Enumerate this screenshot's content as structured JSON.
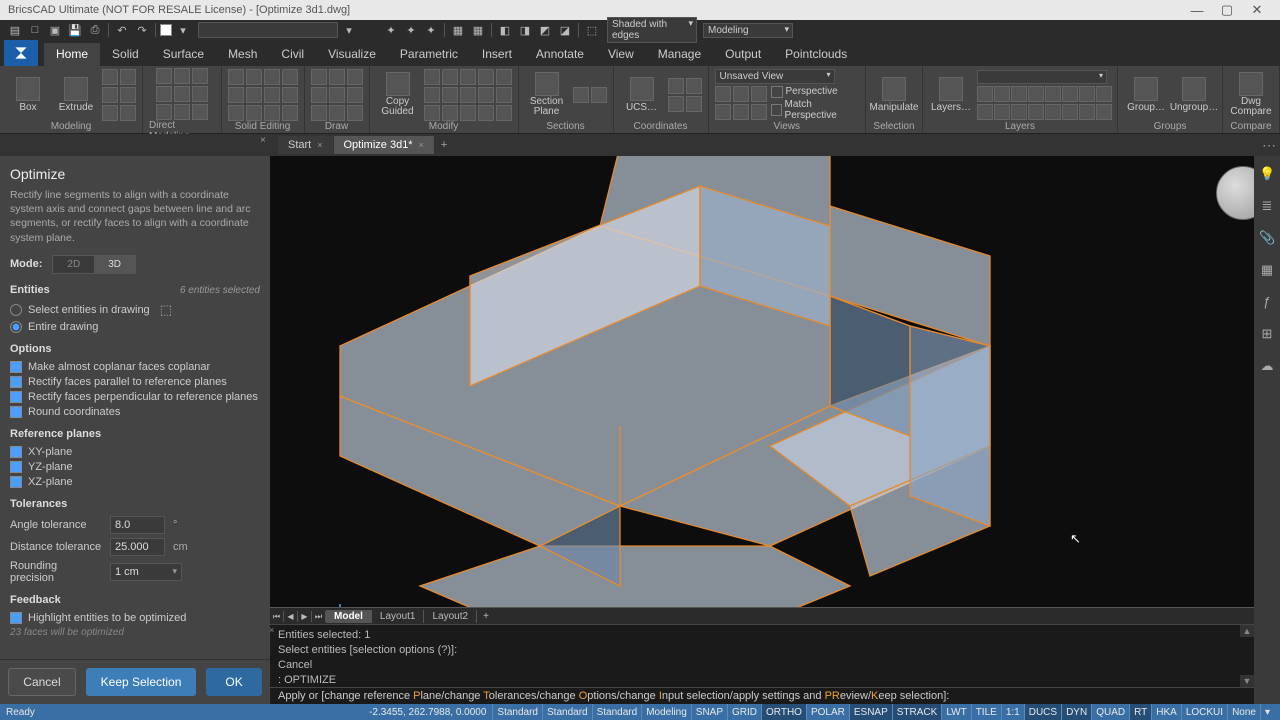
{
  "titlebar": {
    "title": "BricsCAD Ultimate (NOT FOR RESALE License) - [Optimize 3d1.dwg]"
  },
  "qat": {
    "visual_style": "Shaded with edges",
    "workspace": "Modeling"
  },
  "ribbon": {
    "tabs": [
      "Home",
      "Solid",
      "Surface",
      "Mesh",
      "Civil",
      "Visualize",
      "Parametric",
      "Insert",
      "Annotate",
      "View",
      "Manage",
      "Output",
      "Pointclouds"
    ],
    "active": 0,
    "btn_box": "Box",
    "btn_extrude": "Extrude",
    "btn_copy": "Copy Guided",
    "btn_section": "Section Plane",
    "btn_ucs": "UCS…",
    "dd_view": "Unsaved View",
    "ck_persp": "Perspective",
    "ck_match": "Match Perspective",
    "btn_manip": "Manipulate",
    "btn_layers": "Layers…",
    "btn_group": "Group…",
    "btn_ungroup": "Ungroup…",
    "btn_dwg": "Dwg Compare",
    "groups": [
      "Modeling",
      "Direct Modeling",
      "Solid Editing",
      "Draw",
      "Modify",
      "Sections",
      "Coordinates",
      "Views",
      "Selection",
      "Layers",
      "Groups",
      "Compare"
    ]
  },
  "doctabs": {
    "tabs": [
      {
        "name": "Start",
        "active": false
      },
      {
        "name": "Optimize 3d1*",
        "active": true
      }
    ]
  },
  "panel": {
    "title": "Optimize",
    "desc": "Rectify line segments to align with a coordinate system axis and connect gaps between line and arc segments, or rectify faces to align with a coordinate system plane.",
    "mode_label": "Mode:",
    "mode_2d": "2D",
    "mode_3d": "3D",
    "entities_head": "Entities",
    "entities_hint": "6 entities selected",
    "radio_select": "Select entities in drawing",
    "radio_entire": "Entire drawing",
    "options_head": "Options",
    "opt1": "Make almost coplanar faces coplanar",
    "opt2": "Rectify faces parallel to reference planes",
    "opt3": "Rectify faces perpendicular to reference planes",
    "opt4": "Round coordinates",
    "ref_head": "Reference planes",
    "ref1": "XY-plane",
    "ref2": "YZ-plane",
    "ref3": "XZ-plane",
    "tol_head": "Tolerances",
    "tol_angle_lbl": "Angle tolerance",
    "tol_angle_val": "8.0",
    "tol_angle_unit": "°",
    "tol_dist_lbl": "Distance tolerance",
    "tol_dist_val": "25.000",
    "tol_dist_unit": "cm",
    "tol_round_lbl": "Rounding precision",
    "tol_round_val": "1 cm",
    "fb_head": "Feedback",
    "fb1": "Highlight entities to be optimized",
    "fb_note": "23 faces will be optimized",
    "btn_cancel": "Cancel",
    "btn_keep": "Keep Selection",
    "btn_ok": "OK"
  },
  "layout": {
    "tabs": [
      "Model",
      "Layout1",
      "Layout2"
    ],
    "active": 0
  },
  "cmd_hist": [
    "Entities selected: 1",
    "Select entities [selection options (?)]:",
    "Cancel",
    ": OPTIMIZE"
  ],
  "cmd_line": {
    "prefix": "Apply or [change reference ",
    "p": "P",
    "t1": "lane/change ",
    "t": "T",
    "t2": "olerances/change ",
    "o": "O",
    "t3": "ptions/change ",
    "i": "I",
    "t4": "nput selection/apply settings and ",
    "pr": "PR",
    "t5": "eview/",
    "k": "K",
    "t6": "eep selection]:"
  },
  "status": {
    "ready": "Ready",
    "coords": "-2.3455, 262.7988, 0.0000",
    "cells": [
      "Standard",
      "Standard",
      "Standard",
      "Modeling",
      "SNAP",
      "GRID",
      "ORTHO",
      "POLAR",
      "ESNAP",
      "STRACK",
      "LWT",
      "TILE",
      "1:1",
      "DUCS",
      "DYN",
      "QUAD",
      "RT",
      "HKA",
      "LOCKUI",
      "None"
    ],
    "on": {
      "2": false,
      "3": false,
      "4": false,
      "6": true,
      "8": true,
      "9": true,
      "13": true,
      "14": true,
      "16": true
    }
  }
}
